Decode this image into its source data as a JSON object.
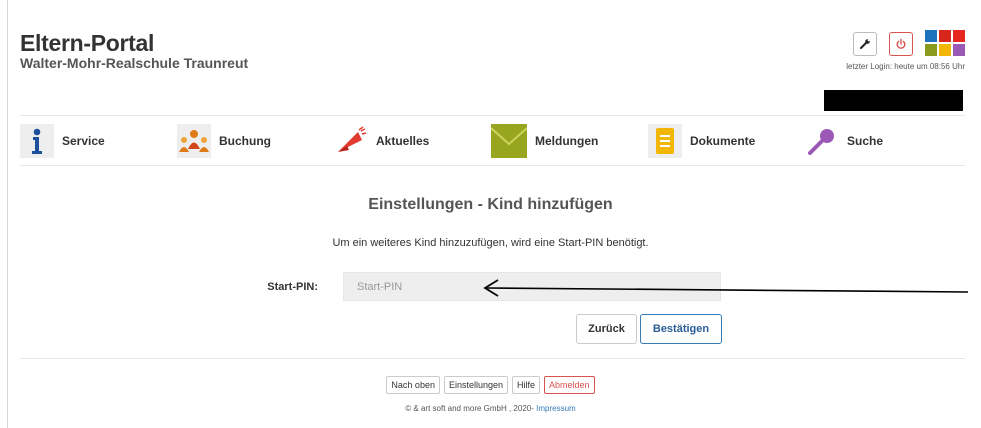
{
  "header": {
    "title": "Eltern-Portal",
    "school": "Walter-Mohr-Realschule Traunreut",
    "last_login": "letzter Login: heute um 08:56 Uhr",
    "colors": {
      "tiles": [
        "#1e73be",
        "#d9261c",
        "#e6261f",
        "#8a9a1c",
        "#f2b705",
        "#9b59b6"
      ]
    }
  },
  "nav": {
    "items": [
      {
        "label": "Service",
        "icon": "info-icon"
      },
      {
        "label": "Buchung",
        "icon": "people-icon"
      },
      {
        "label": "Aktuelles",
        "icon": "megaphone-icon"
      },
      {
        "label": "Meldungen",
        "icon": "envelope-icon"
      },
      {
        "label": "Dokumente",
        "icon": "document-icon"
      },
      {
        "label": "Suche",
        "icon": "magnifier-icon"
      }
    ]
  },
  "main": {
    "title": "Einstellungen - Kind hinzufügen",
    "info": "Um ein weiteres Kind hinzuzufügen, wird eine Start-PIN benötigt.",
    "pin_label": "Start-PIN:",
    "pin_placeholder": "Start-PIN",
    "pin_value": "",
    "back_label": "Zurück",
    "confirm_label": "Bestätigen"
  },
  "footer": {
    "links": [
      "Nach oben",
      "Einstellungen",
      "Hilfe",
      "Abmelden"
    ],
    "copyright": "© & art soft and more GmbH , 2020-",
    "impressum": "Impressum"
  }
}
